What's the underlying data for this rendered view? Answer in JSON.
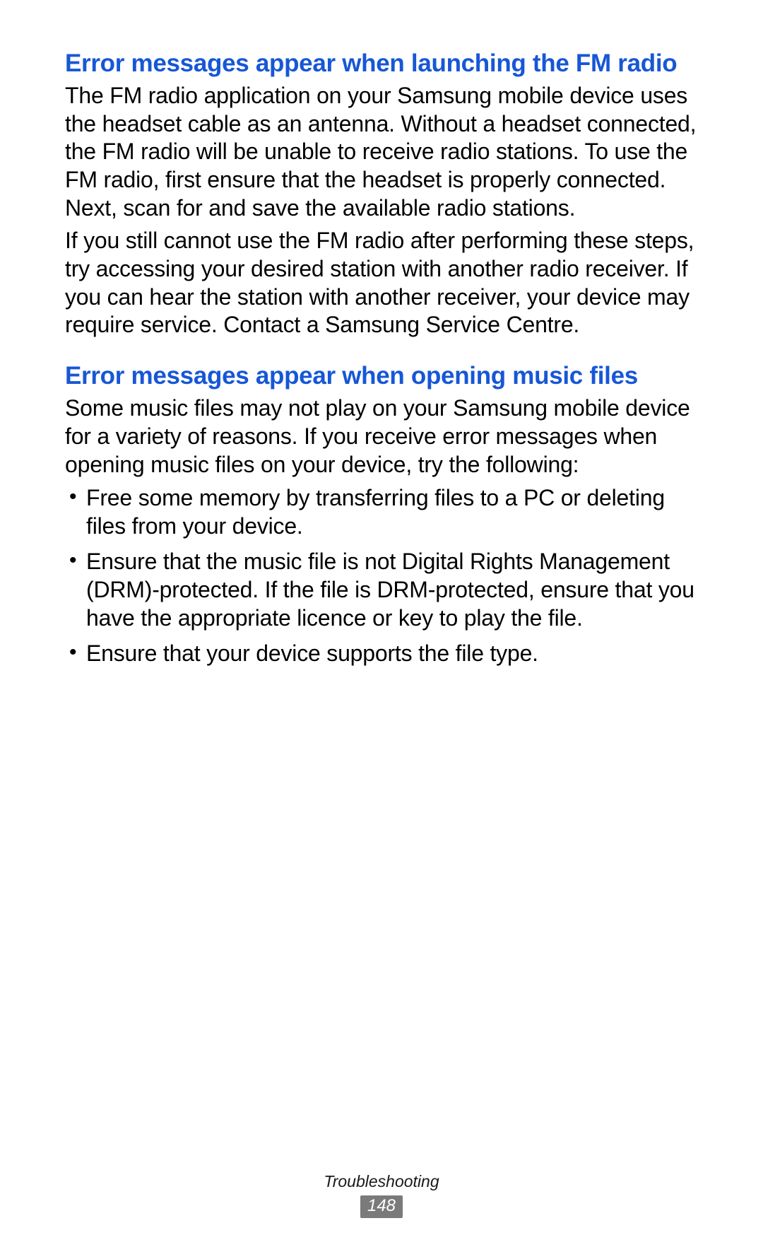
{
  "sections": [
    {
      "heading": "Error messages appear when launching the FM radio",
      "paragraphs": [
        "The FM radio application on your Samsung mobile device uses the headset cable as an antenna. Without a headset connected, the FM radio will be unable to receive radio stations. To use the FM radio, first ensure that the headset is properly connected. Next, scan for and save the available radio stations.",
        "If you still cannot use the FM radio after performing these steps, try accessing your desired station with another radio receiver. If you can hear the station with another receiver, your device may require service. Contact a Samsung Service Centre."
      ],
      "bullets": []
    },
    {
      "heading": "Error messages appear when opening music files",
      "paragraphs": [
        "Some music files may not play on your Samsung mobile device for a variety of reasons. If you receive error messages when opening music files on your device, try the following:"
      ],
      "bullets": [
        "Free some memory by transferring files to a PC or deleting files from your device.",
        "Ensure that the music file is not Digital Rights Management (DRM)-protected. If the file is DRM-protected, ensure that you have the appropriate licence or key to play the file.",
        "Ensure that your device supports the file type."
      ]
    }
  ],
  "footer": {
    "section_label": "Troubleshooting",
    "page_number": "148"
  }
}
